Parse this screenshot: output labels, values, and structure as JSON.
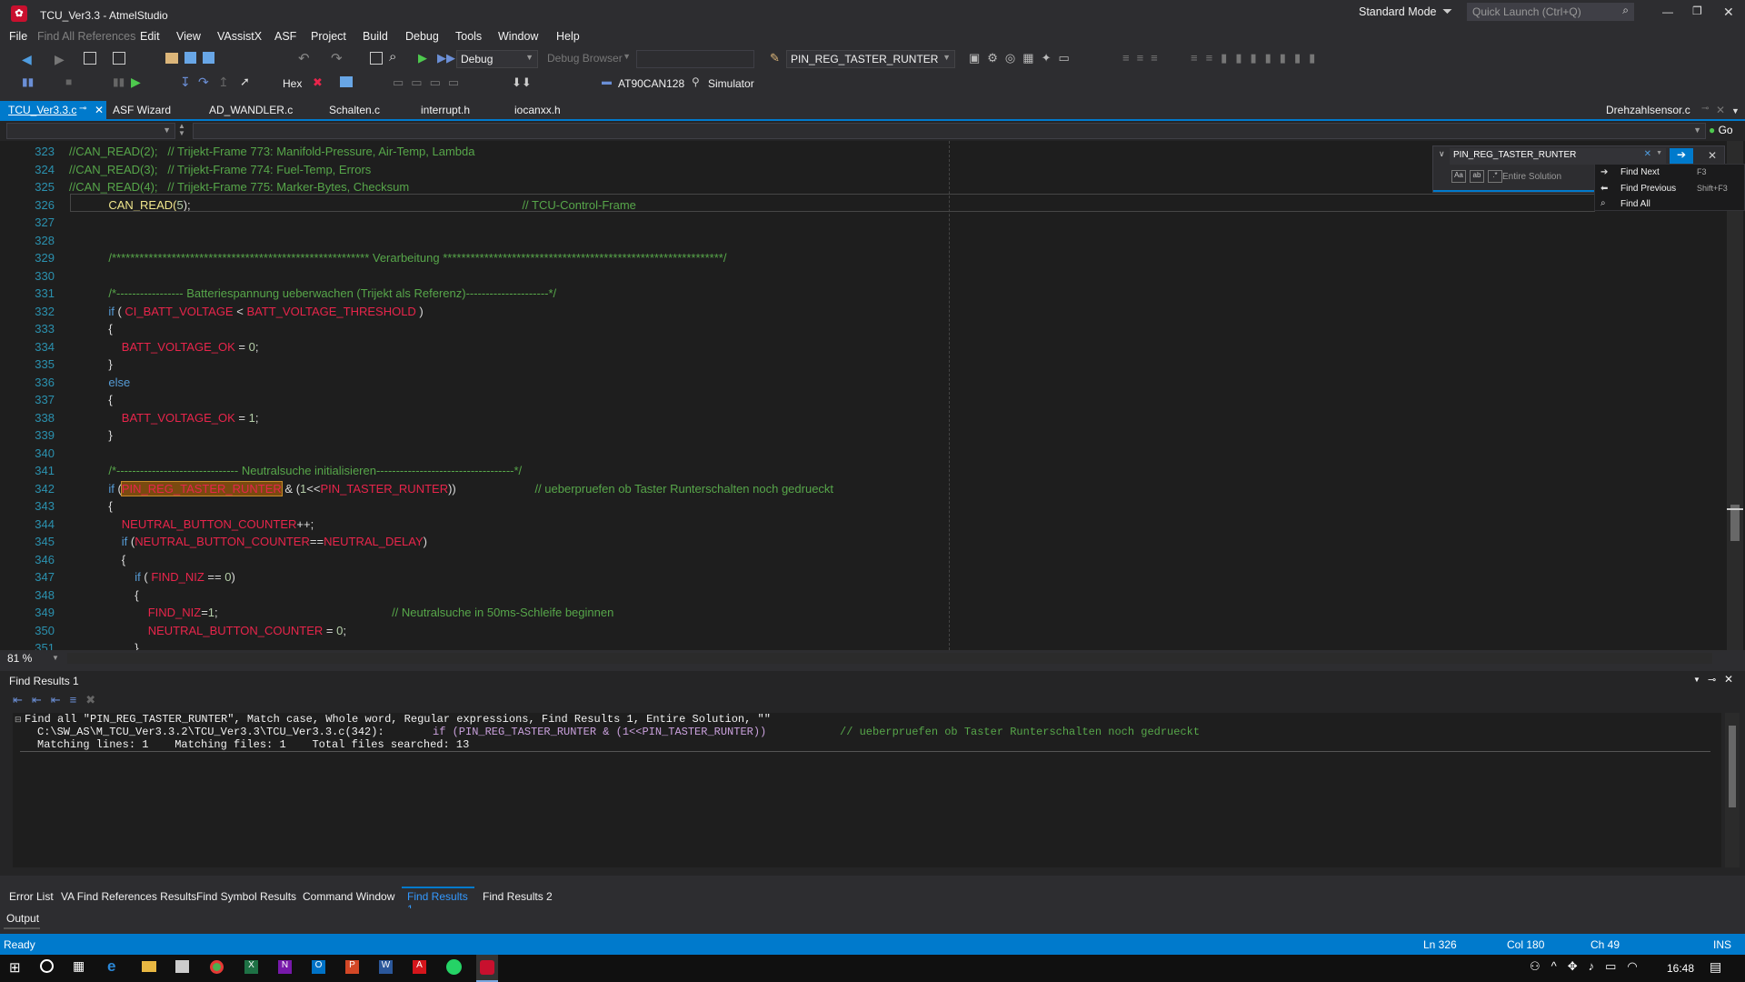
{
  "window": {
    "title": "TCU_Ver3.3 - AtmelStudio",
    "mode": "Standard Mode",
    "quick_launch_placeholder": "Quick Launch (Ctrl+Q)"
  },
  "menu": [
    "File",
    "Find All References",
    "Edit",
    "View",
    "VAssistX",
    "ASF",
    "Project",
    "Build",
    "Debug",
    "Tools",
    "Window",
    "Help"
  ],
  "toolbar": {
    "config": "Debug",
    "debug_browser": "Debug Browser",
    "find_combo": "PIN_REG_TASTER_RUNTER",
    "hex": "Hex",
    "device": "AT90CAN128",
    "tool": "Simulator"
  },
  "tabs": {
    "items": [
      "TCU_Ver3.3.c",
      "ASF Wizard",
      "AD_WANDLER.c",
      "Schalten.c",
      "interrupt.h",
      "iocanxx.h"
    ],
    "right": "Drehzahlsensor.c",
    "go": "Go"
  },
  "editor": {
    "lines": [
      {
        "n": "323",
        "t": [
          [
            "cmt",
            "//CAN_READ(2);   // Trijekt-Frame 773: Manifold-Pressure, Air-Temp, Lambda"
          ]
        ]
      },
      {
        "n": "324",
        "t": [
          [
            "cmt",
            "//CAN_READ(3);   // Trijekt-Frame 774: Fuel-Temp, Errors"
          ]
        ]
      },
      {
        "n": "325",
        "t": [
          [
            "cmt",
            "//CAN_READ(4);   // Trijekt-Frame 775: Marker-Bytes, Checksum"
          ]
        ]
      },
      {
        "n": "326",
        "t": [
          [
            "",
            "            "
          ],
          [
            "fn",
            "CAN_READ("
          ],
          [
            "num",
            "5"
          ],
          [
            "",
            "); "
          ],
          [
            "cmt",
            "                                                                                                    // TCU-Control-Frame"
          ]
        ]
      },
      {
        "n": "327",
        "t": []
      },
      {
        "n": "328",
        "t": []
      },
      {
        "n": "329",
        "t": [
          [
            "",
            "            "
          ],
          [
            "cmt",
            "/******************************************************** Verarbeitung *************************************************************/"
          ]
        ]
      },
      {
        "n": "330",
        "t": []
      },
      {
        "n": "331",
        "t": [
          [
            "",
            "            "
          ],
          [
            "cmt",
            "/*----------------- Batteriespannung ueberwachen (Trijekt als Referenz)---------------------*/"
          ]
        ]
      },
      {
        "n": "332",
        "t": [
          [
            "",
            "            "
          ],
          [
            "kw",
            "if"
          ],
          [
            "",
            " ( "
          ],
          [
            "mac",
            "CI_BATT_VOLTAGE"
          ],
          [
            "",
            " < "
          ],
          [
            "mac",
            "BATT_VOLTAGE_THRESHOLD"
          ],
          [
            "",
            " )"
          ]
        ]
      },
      {
        "n": "333",
        "t": [
          [
            "",
            "            {"
          ]
        ]
      },
      {
        "n": "334",
        "t": [
          [
            "",
            "                "
          ],
          [
            "mac",
            "BATT_VOLTAGE_OK"
          ],
          [
            "",
            " = "
          ],
          [
            "num",
            "0"
          ],
          [
            "",
            ";"
          ]
        ]
      },
      {
        "n": "335",
        "t": [
          [
            "",
            "            }"
          ]
        ]
      },
      {
        "n": "336",
        "t": [
          [
            "",
            "            "
          ],
          [
            "kw",
            "else"
          ]
        ]
      },
      {
        "n": "337",
        "t": [
          [
            "",
            "            {"
          ]
        ]
      },
      {
        "n": "338",
        "t": [
          [
            "",
            "                "
          ],
          [
            "mac",
            "BATT_VOLTAGE_OK"
          ],
          [
            "",
            " = "
          ],
          [
            "num",
            "1"
          ],
          [
            "",
            ";"
          ]
        ]
      },
      {
        "n": "339",
        "t": [
          [
            "",
            "            }"
          ]
        ]
      },
      {
        "n": "340",
        "t": []
      },
      {
        "n": "341",
        "t": [
          [
            "",
            "            "
          ],
          [
            "cmt",
            "/*------------------------------- Neutralsuche initialisieren-----------------------------------*/"
          ]
        ]
      },
      {
        "n": "342",
        "t": [
          [
            "",
            "            "
          ],
          [
            "kw",
            "if"
          ],
          [
            "",
            " ("
          ],
          [
            "hl",
            "PIN_REG_TASTER_RUNTER"
          ],
          [
            "",
            " & ("
          ],
          [
            "num",
            "1"
          ],
          [
            "",
            "<<"
          ],
          [
            "mac",
            "PIN_TASTER_RUNTER"
          ],
          [
            "",
            "))"
          ],
          [
            "cmt",
            "                        // ueberpruefen ob Taster Runterschalten noch gedrueckt"
          ]
        ]
      },
      {
        "n": "343",
        "t": [
          [
            "",
            "            {"
          ]
        ]
      },
      {
        "n": "344",
        "t": [
          [
            "",
            "                "
          ],
          [
            "mac",
            "NEUTRAL_BUTTON_COUNTER"
          ],
          [
            "",
            "++;"
          ]
        ]
      },
      {
        "n": "345",
        "t": [
          [
            "",
            "                "
          ],
          [
            "kw",
            "if"
          ],
          [
            "",
            " ("
          ],
          [
            "mac",
            "NEUTRAL_BUTTON_COUNTER"
          ],
          [
            "",
            "=="
          ],
          [
            "mac",
            "NEUTRAL_DELAY"
          ],
          [
            "",
            ")"
          ]
        ]
      },
      {
        "n": "346",
        "t": [
          [
            "",
            "                {"
          ]
        ]
      },
      {
        "n": "347",
        "t": [
          [
            "",
            "                    "
          ],
          [
            "kw",
            "if"
          ],
          [
            "",
            " ( "
          ],
          [
            "mac",
            "FIND_NIZ"
          ],
          [
            "",
            " == "
          ],
          [
            "num",
            "0"
          ],
          [
            "",
            ")"
          ]
        ]
      },
      {
        "n": "348",
        "t": [
          [
            "",
            "                    {"
          ]
        ]
      },
      {
        "n": "349",
        "t": [
          [
            "",
            "                        "
          ],
          [
            "mac",
            "FIND_NIZ"
          ],
          [
            "",
            "="
          ],
          [
            "num",
            "1"
          ],
          [
            "",
            ";"
          ],
          [
            "cmt",
            "                                                     // Neutralsuche in 50ms-Schleife beginnen"
          ]
        ]
      },
      {
        "n": "350",
        "t": [
          [
            "",
            "                        "
          ],
          [
            "mac",
            "NEUTRAL_BUTTON_COUNTER"
          ],
          [
            "",
            " = "
          ],
          [
            "num",
            "0"
          ],
          [
            "",
            ";"
          ]
        ]
      },
      {
        "n": "351",
        "t": [
          [
            "",
            "                    }"
          ]
        ]
      }
    ],
    "zoom": "81 %"
  },
  "find_widget": {
    "query": "PIN_REG_TASTER_RUNTER",
    "scope": "Entire Solution",
    "items": [
      {
        "label": "Find Next",
        "key": "F3"
      },
      {
        "label": "Find Previous",
        "key": "Shift+F3"
      },
      {
        "label": "Find All",
        "key": ""
      }
    ]
  },
  "find_results": {
    "title": "Find Results 1",
    "line1": "Find all \"PIN_REG_TASTER_RUNTER\", Match case, Whole word, Regular expressions, Find Results 1, Entire Solution, \"\"",
    "line2a": "C:\\SW_AS\\M_TCU_Ver3.3.2\\TCU_Ver3.3\\TCU_Ver3.3.c(342):",
    "line2b": "if (PIN_REG_TASTER_RUNTER & (1<<PIN_TASTER_RUNTER))",
    "line2c": "// ueberpruefen ob Taster Runterschalten noch gedrueckt",
    "line3": "Matching lines: 1    Matching files: 1    Total files searched: 13"
  },
  "bottom_tabs": [
    "Error List",
    "VA Find References Results",
    "Find Symbol Results",
    "Command Window",
    "Find Results 1",
    "Find Results 2"
  ],
  "output": "Output",
  "status": {
    "ready": "Ready",
    "ln": "Ln 326",
    "col": "Col 180",
    "ch": "Ch 49",
    "ins": "INS",
    "time": "16:48"
  },
  "colors": {
    "accent": "#007acc",
    "comment": "#57a64a",
    "keyword": "#569cd6",
    "macro": "#e8254b",
    "linenum": "#2b91af"
  }
}
